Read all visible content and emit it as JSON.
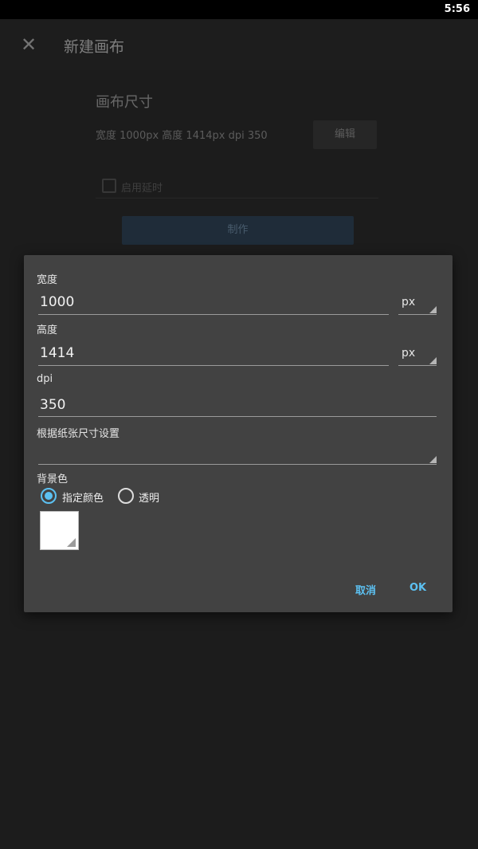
{
  "status_bar": {
    "time": "5:56"
  },
  "app_bar": {
    "title": "新建画布",
    "close_icon": "close-icon"
  },
  "background": {
    "section_title": "画布尺寸",
    "size_info": "宽度 1000px  高度 1414px  dpi 350",
    "edit_button": "编辑",
    "delay_checkbox_label": "启用延时",
    "make_button": "制作"
  },
  "dialog": {
    "width_label": "宽度",
    "width_value": "1000",
    "width_unit": "px",
    "height_label": "高度",
    "height_value": "1414",
    "height_unit": "px",
    "dpi_label": "dpi",
    "dpi_value": "350",
    "paper_label": "根据纸张尺寸设置",
    "paper_value": "",
    "bg_label": "背景色",
    "radio_specify": "指定颜色",
    "radio_transparent": "透明",
    "selected_background": "指定颜色",
    "swatch_color": "#ffffff",
    "cancel_button": "取消",
    "ok_button": "OK",
    "accent_color": "#5cc1f2"
  }
}
